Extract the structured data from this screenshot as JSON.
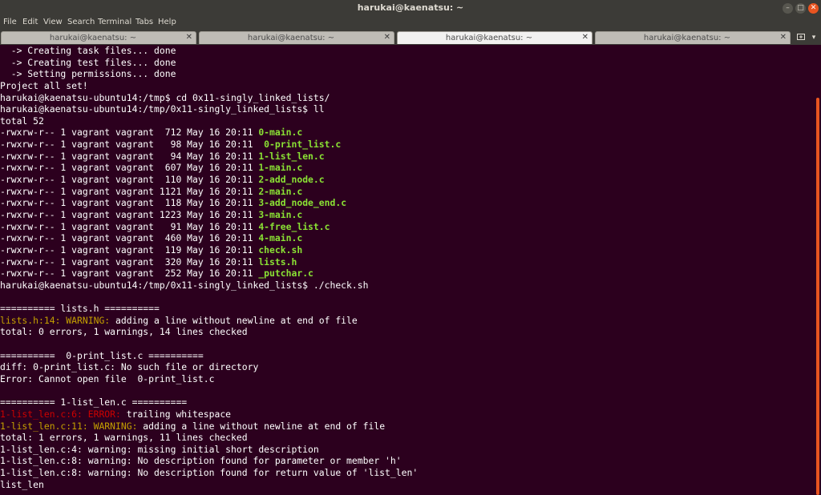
{
  "window": {
    "title": "harukai@kaenatsu: ~",
    "minimize": "–",
    "maximize": "□",
    "close": "✕"
  },
  "menu": [
    "File",
    "Edit",
    "View",
    "Search",
    "Terminal",
    "Tabs",
    "Help"
  ],
  "tabs": [
    {
      "label": "harukai@kaenatsu: ~",
      "active": false
    },
    {
      "label": "harukai@kaenatsu: ~",
      "active": false
    },
    {
      "label": "harukai@kaenatsu: ~",
      "active": true
    },
    {
      "label": "harukai@kaenatsu: ~",
      "active": false
    }
  ],
  "tab_close_glyph": "✕",
  "new_tab_icon": "new-tab-icon",
  "tab_menu_icon": "chevron-down-icon",
  "colors": {
    "background": "#2c001e",
    "text": "#ffffff",
    "executable": "#8ae234",
    "warning": "#c4a000",
    "error": "#cc0000",
    "accent": "#e95420"
  },
  "terminal_lines": [
    [
      {
        "t": "  -> Creating task files... done"
      }
    ],
    [
      {
        "t": "  -> Creating test files... done"
      }
    ],
    [
      {
        "t": "  -> Setting permissions... done"
      }
    ],
    [
      {
        "t": "Project all set!"
      }
    ],
    [
      {
        "t": "harukai@kaenatsu-ubuntu14:/tmp$ cd 0x11-singly_linked_lists/"
      }
    ],
    [
      {
        "t": "harukai@kaenatsu-ubuntu14:/tmp/0x11-singly_linked_lists$ ll"
      }
    ],
    [
      {
        "t": "total 52"
      }
    ],
    [
      {
        "t": "-rwxrw-r-- 1 vagrant vagrant  712 May 16 20:11 "
      },
      {
        "t": "0-main.c",
        "c": "g"
      }
    ],
    [
      {
        "t": "-rwxrw-r-- 1 vagrant vagrant   98 May 16 20:11 "
      },
      {
        "t": " 0-print_list.c",
        "c": "g"
      }
    ],
    [
      {
        "t": "-rwxrw-r-- 1 vagrant vagrant   94 May 16 20:11 "
      },
      {
        "t": "1-list_len.c",
        "c": "g"
      }
    ],
    [
      {
        "t": "-rwxrw-r-- 1 vagrant vagrant  607 May 16 20:11 "
      },
      {
        "t": "1-main.c",
        "c": "g"
      }
    ],
    [
      {
        "t": "-rwxrw-r-- 1 vagrant vagrant  110 May 16 20:11 "
      },
      {
        "t": "2-add_node.c",
        "c": "g"
      }
    ],
    [
      {
        "t": "-rwxrw-r-- 1 vagrant vagrant 1121 May 16 20:11 "
      },
      {
        "t": "2-main.c",
        "c": "g"
      }
    ],
    [
      {
        "t": "-rwxrw-r-- 1 vagrant vagrant  118 May 16 20:11 "
      },
      {
        "t": "3-add_node_end.c",
        "c": "g"
      }
    ],
    [
      {
        "t": "-rwxrw-r-- 1 vagrant vagrant 1223 May 16 20:11 "
      },
      {
        "t": "3-main.c",
        "c": "g"
      }
    ],
    [
      {
        "t": "-rwxrw-r-- 1 vagrant vagrant   91 May 16 20:11 "
      },
      {
        "t": "4-free_list.c",
        "c": "g"
      }
    ],
    [
      {
        "t": "-rwxrw-r-- 1 vagrant vagrant  460 May 16 20:11 "
      },
      {
        "t": "4-main.c",
        "c": "g"
      }
    ],
    [
      {
        "t": "-rwxrw-r-- 1 vagrant vagrant  119 May 16 20:11 "
      },
      {
        "t": "check.sh",
        "c": "g"
      }
    ],
    [
      {
        "t": "-rwxrw-r-- 1 vagrant vagrant  320 May 16 20:11 "
      },
      {
        "t": "lists.h",
        "c": "g"
      }
    ],
    [
      {
        "t": "-rwxrw-r-- 1 vagrant vagrant  252 May 16 20:11 "
      },
      {
        "t": "_putchar.c",
        "c": "g"
      }
    ],
    [
      {
        "t": "harukai@kaenatsu-ubuntu14:/tmp/0x11-singly_linked_lists$ ./check.sh"
      }
    ],
    [
      {
        "t": ""
      }
    ],
    [
      {
        "t": "========== lists.h =========="
      }
    ],
    [
      {
        "t": "lists.h:14: WARNING:",
        "c": "y"
      },
      {
        "t": " adding a line without newline at end of file"
      }
    ],
    [
      {
        "t": "total: 0 errors, 1 warnings, 14 lines checked"
      }
    ],
    [
      {
        "t": ""
      }
    ],
    [
      {
        "t": "==========  0-print_list.c =========="
      }
    ],
    [
      {
        "t": "diff: 0-print_list.c: No such file or directory"
      }
    ],
    [
      {
        "t": "Error: Cannot open file  0-print_list.c"
      }
    ],
    [
      {
        "t": ""
      }
    ],
    [
      {
        "t": "========== 1-list_len.c =========="
      }
    ],
    [
      {
        "t": "1-list_len.c:6: ERROR:",
        "c": "r"
      },
      {
        "t": " trailing whitespace"
      }
    ],
    [
      {
        "t": "1-list_len.c:11: WARNING:",
        "c": "y"
      },
      {
        "t": " adding a line without newline at end of file"
      }
    ],
    [
      {
        "t": "total: 1 errors, 1 warnings, 11 lines checked"
      }
    ],
    [
      {
        "t": "1-list_len.c:4: warning: missing initial short description"
      }
    ],
    [
      {
        "t": "1-list_len.c:8: warning: No description found for parameter or member 'h'"
      }
    ],
    [
      {
        "t": "1-list_len.c:8: warning: No description found for return value of 'list_len'"
      }
    ],
    [
      {
        "t": "list_len"
      }
    ]
  ]
}
